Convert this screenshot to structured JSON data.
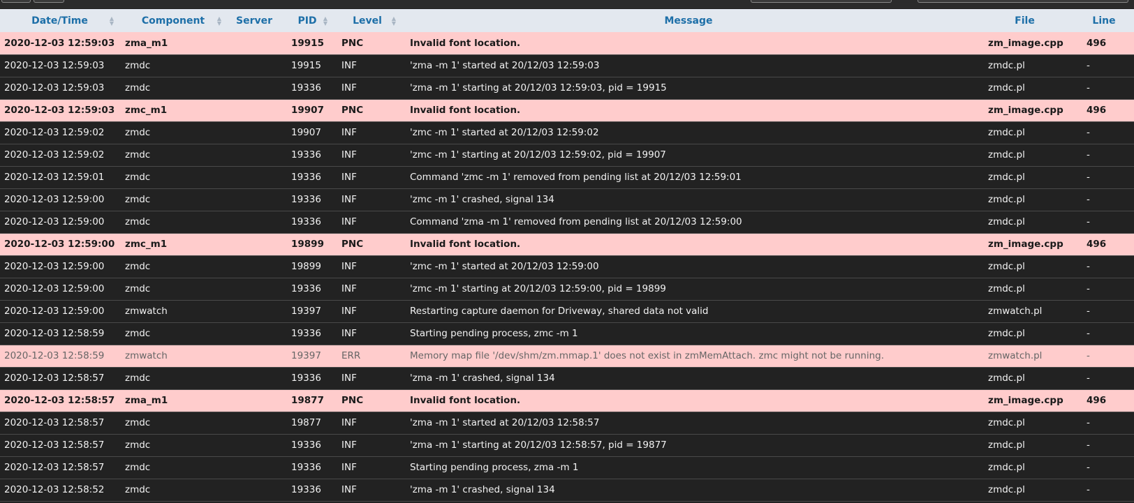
{
  "colors": {
    "header_bg": "#e3e8ef",
    "header_text": "#1d6fa8",
    "row_inf_bg": "#222222",
    "row_alert_bg": "#ffcccc"
  },
  "columns": [
    "Date/Time",
    "Component",
    "Server",
    "PID",
    "Level",
    "Message",
    "File",
    "Line"
  ],
  "rows": [
    {
      "datetime": "2020-12-03 12:59:03",
      "component": "zma_m1",
      "server": "",
      "pid": "19915",
      "level": "PNC",
      "message": "Invalid font location.",
      "file": "zm_image.cpp",
      "line": "496"
    },
    {
      "datetime": "2020-12-03 12:59:03",
      "component": "zmdc",
      "server": "",
      "pid": "19915",
      "level": "INF",
      "message": "'zma -m 1' started at 20/12/03 12:59:03",
      "file": "zmdc.pl",
      "line": "-"
    },
    {
      "datetime": "2020-12-03 12:59:03",
      "component": "zmdc",
      "server": "",
      "pid": "19336",
      "level": "INF",
      "message": "'zma -m 1' starting at 20/12/03 12:59:03, pid = 19915",
      "file": "zmdc.pl",
      "line": "-"
    },
    {
      "datetime": "2020-12-03 12:59:03",
      "component": "zmc_m1",
      "server": "",
      "pid": "19907",
      "level": "PNC",
      "message": "Invalid font location.",
      "file": "zm_image.cpp",
      "line": "496"
    },
    {
      "datetime": "2020-12-03 12:59:02",
      "component": "zmdc",
      "server": "",
      "pid": "19907",
      "level": "INF",
      "message": "'zmc -m 1' started at 20/12/03 12:59:02",
      "file": "zmdc.pl",
      "line": "-"
    },
    {
      "datetime": "2020-12-03 12:59:02",
      "component": "zmdc",
      "server": "",
      "pid": "19336",
      "level": "INF",
      "message": "'zmc -m 1' starting at 20/12/03 12:59:02, pid = 19907",
      "file": "zmdc.pl",
      "line": "-"
    },
    {
      "datetime": "2020-12-03 12:59:01",
      "component": "zmdc",
      "server": "",
      "pid": "19336",
      "level": "INF",
      "message": "Command 'zmc -m 1' removed from pending list at 20/12/03 12:59:01",
      "file": "zmdc.pl",
      "line": "-"
    },
    {
      "datetime": "2020-12-03 12:59:00",
      "component": "zmdc",
      "server": "",
      "pid": "19336",
      "level": "INF",
      "message": "'zmc -m 1' crashed, signal 134",
      "file": "zmdc.pl",
      "line": "-"
    },
    {
      "datetime": "2020-12-03 12:59:00",
      "component": "zmdc",
      "server": "",
      "pid": "19336",
      "level": "INF",
      "message": "Command 'zma -m 1' removed from pending list at 20/12/03 12:59:00",
      "file": "zmdc.pl",
      "line": "-"
    },
    {
      "datetime": "2020-12-03 12:59:00",
      "component": "zmc_m1",
      "server": "",
      "pid": "19899",
      "level": "PNC",
      "message": "Invalid font location.",
      "file": "zm_image.cpp",
      "line": "496"
    },
    {
      "datetime": "2020-12-03 12:59:00",
      "component": "zmdc",
      "server": "",
      "pid": "19899",
      "level": "INF",
      "message": "'zmc -m 1' started at 20/12/03 12:59:00",
      "file": "zmdc.pl",
      "line": "-"
    },
    {
      "datetime": "2020-12-03 12:59:00",
      "component": "zmdc",
      "server": "",
      "pid": "19336",
      "level": "INF",
      "message": "'zmc -m 1' starting at 20/12/03 12:59:00, pid = 19899",
      "file": "zmdc.pl",
      "line": "-"
    },
    {
      "datetime": "2020-12-03 12:59:00",
      "component": "zmwatch",
      "server": "",
      "pid": "19397",
      "level": "INF",
      "message": "Restarting capture daemon for Driveway, shared data not valid",
      "file": "zmwatch.pl",
      "line": "-"
    },
    {
      "datetime": "2020-12-03 12:58:59",
      "component": "zmdc",
      "server": "",
      "pid": "19336",
      "level": "INF",
      "message": "Starting pending process, zmc -m 1",
      "file": "zmdc.pl",
      "line": "-"
    },
    {
      "datetime": "2020-12-03 12:58:59",
      "component": "zmwatch",
      "server": "",
      "pid": "19397",
      "level": "ERR",
      "message": "Memory map file '/dev/shm/zm.mmap.1' does not exist in zmMemAttach. zmc might not be running.",
      "file": "zmwatch.pl",
      "line": "-"
    },
    {
      "datetime": "2020-12-03 12:58:57",
      "component": "zmdc",
      "server": "",
      "pid": "19336",
      "level": "INF",
      "message": "'zma -m 1' crashed, signal 134",
      "file": "zmdc.pl",
      "line": "-"
    },
    {
      "datetime": "2020-12-03 12:58:57",
      "component": "zma_m1",
      "server": "",
      "pid": "19877",
      "level": "PNC",
      "message": "Invalid font location.",
      "file": "zm_image.cpp",
      "line": "496"
    },
    {
      "datetime": "2020-12-03 12:58:57",
      "component": "zmdc",
      "server": "",
      "pid": "19877",
      "level": "INF",
      "message": "'zma -m 1' started at 20/12/03 12:58:57",
      "file": "zmdc.pl",
      "line": "-"
    },
    {
      "datetime": "2020-12-03 12:58:57",
      "component": "zmdc",
      "server": "",
      "pid": "19336",
      "level": "INF",
      "message": "'zma -m 1' starting at 20/12/03 12:58:57, pid = 19877",
      "file": "zmdc.pl",
      "line": "-"
    },
    {
      "datetime": "2020-12-03 12:58:57",
      "component": "zmdc",
      "server": "",
      "pid": "19336",
      "level": "INF",
      "message": "Starting pending process, zma -m 1",
      "file": "zmdc.pl",
      "line": "-"
    },
    {
      "datetime": "2020-12-03 12:58:52",
      "component": "zmdc",
      "server": "",
      "pid": "19336",
      "level": "INF",
      "message": "'zma -m 1' crashed, signal 134",
      "file": "zmdc.pl",
      "line": "-"
    }
  ]
}
